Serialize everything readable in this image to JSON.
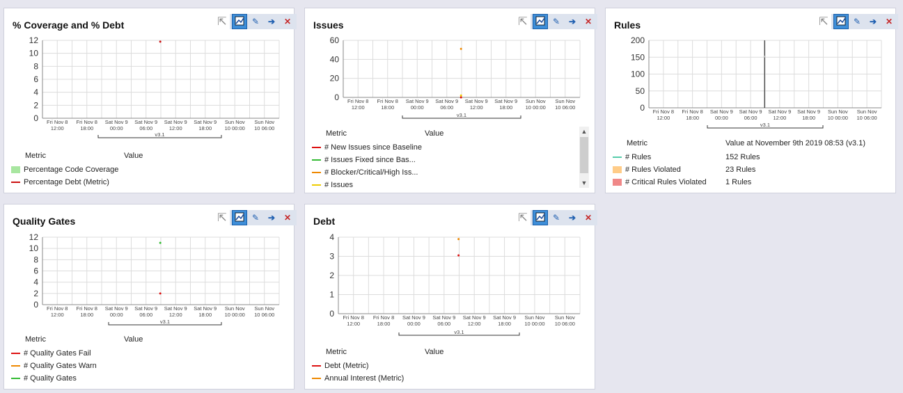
{
  "common": {
    "x_ticks": [
      [
        "Fri Nov 8",
        "12:00"
      ],
      [
        "Fri Nov 8",
        "18:00"
      ],
      [
        "Sat Nov 9",
        "00:00"
      ],
      [
        "Sat Nov 9",
        "06:00"
      ],
      [
        "Sat Nov 9",
        "12:00"
      ],
      [
        "Sat Nov 9",
        "18:00"
      ],
      [
        "Sun Nov",
        "10  00:00"
      ],
      [
        "Sun Nov",
        "10  06:00"
      ]
    ],
    "version_label": "v3.1",
    "metric_header": "Metric",
    "value_header": "Value"
  },
  "toolbar": {
    "icons": [
      "cursor-icon",
      "chart-icon",
      "pencil-icon",
      "arrow-icon",
      "close-icon"
    ]
  },
  "panels": {
    "coverage": {
      "title": "% Coverage and % Debt",
      "legend": [
        {
          "label": "Percentage Code Coverage",
          "color": "#a8e6a0",
          "kind": "box"
        },
        {
          "label": "Percentage Debt (Metric)",
          "color": "#cc1111",
          "kind": "line"
        }
      ]
    },
    "issues": {
      "title": "Issues",
      "legend": [
        {
          "label": "# New Issues since Baseline",
          "color": "#dd1111",
          "kind": "line"
        },
        {
          "label": "# Issues Fixed since Bas...",
          "color": "#33bb33",
          "kind": "line"
        },
        {
          "label": "# Blocker/Critical/High Iss...",
          "color": "#ee8800",
          "kind": "line"
        },
        {
          "label": "# Issues",
          "color": "#eecc00",
          "kind": "line"
        }
      ]
    },
    "rules": {
      "title": "Rules",
      "value_header": "Value at November 9th 2019  08:53  (v3.1)",
      "legend": [
        {
          "label": "# Rules",
          "value": "152 Rules",
          "color": "#55ccaa",
          "kind": "line"
        },
        {
          "label": "# Rules Violated",
          "value": "23 Rules",
          "color": "#ffcc88",
          "kind": "box"
        },
        {
          "label": "# Critical Rules Violated",
          "value": "1 Rules",
          "color": "#f08888",
          "kind": "box"
        }
      ]
    },
    "gates": {
      "title": "Quality Gates",
      "legend": [
        {
          "label": "# Quality Gates Fail",
          "color": "#dd1111",
          "kind": "line"
        },
        {
          "label": "# Quality Gates Warn",
          "color": "#ee8800",
          "kind": "line"
        },
        {
          "label": "# Quality Gates",
          "color": "#33bb33",
          "kind": "line"
        }
      ]
    },
    "debt": {
      "title": "Debt",
      "legend": [
        {
          "label": "Debt (Metric)",
          "color": "#dd1111",
          "kind": "line"
        },
        {
          "label": "Annual Interest (Metric)",
          "color": "#ee8800",
          "kind": "line"
        }
      ]
    }
  },
  "chart_data": [
    {
      "id": "coverage",
      "type": "scatter",
      "ylim": [
        0,
        12
      ],
      "yticks": [
        0,
        2,
        4,
        6,
        8,
        10,
        12
      ],
      "x_range": [
        "2019-11-08 09:00",
        "2019-11-10 09:00"
      ],
      "series": [
        {
          "name": "Percentage Debt (Metric)",
          "color": "#cc1111",
          "points": [
            [
              "2019-11-09 08:53",
              11.8
            ]
          ]
        }
      ]
    },
    {
      "id": "issues",
      "type": "scatter",
      "ylim": [
        0,
        60
      ],
      "yticks": [
        0,
        20,
        40,
        60
      ],
      "x_range": [
        "2019-11-08 09:00",
        "2019-11-10 09:00"
      ],
      "series": [
        {
          "name": "# Blocker/Critical/High Iss...",
          "color": "#ee8800",
          "points": [
            [
              "2019-11-09 08:53",
              51
            ]
          ]
        },
        {
          "name": "# Issues",
          "color": "#eecc00",
          "points": [
            [
              "2019-11-09 08:53",
              2
            ]
          ]
        },
        {
          "name": "# New Issues since Baseline",
          "color": "#dd1111",
          "points": [
            [
              "2019-11-09 08:53",
              0
            ]
          ]
        }
      ]
    },
    {
      "id": "rules",
      "type": "line",
      "ylim": [
        0,
        200
      ],
      "yticks": [
        0,
        50,
        100,
        150,
        200
      ],
      "x_range": [
        "2019-11-08 09:00",
        "2019-11-10 09:00"
      ],
      "series": [
        {
          "name": "# Rules",
          "color": "#333333",
          "points": [
            [
              "2019-11-09 08:53",
              152
            ]
          ]
        }
      ]
    },
    {
      "id": "gates",
      "type": "scatter",
      "ylim": [
        0,
        12
      ],
      "yticks": [
        0,
        2,
        4,
        6,
        8,
        10,
        12
      ],
      "x_range": [
        "2019-11-08 09:00",
        "2019-11-10 09:00"
      ],
      "series": [
        {
          "name": "# Quality Gates",
          "color": "#33bb33",
          "points": [
            [
              "2019-11-09 08:53",
              11
            ]
          ]
        },
        {
          "name": "# Quality Gates Fail",
          "color": "#dd1111",
          "points": [
            [
              "2019-11-09 08:53",
              2
            ]
          ]
        }
      ]
    },
    {
      "id": "debt",
      "type": "scatter",
      "ylim": [
        0,
        4
      ],
      "yticks": [
        0,
        1,
        2,
        3,
        4
      ],
      "x_range": [
        "2019-11-08 09:00",
        "2019-11-10 09:00"
      ],
      "series": [
        {
          "name": "Annual Interest (Metric)",
          "color": "#ee8800",
          "points": [
            [
              "2019-11-09 08:53",
              3.9
            ]
          ]
        },
        {
          "name": "Debt (Metric)",
          "color": "#dd1111",
          "points": [
            [
              "2019-11-09 08:53",
              3.05
            ]
          ]
        }
      ]
    }
  ]
}
